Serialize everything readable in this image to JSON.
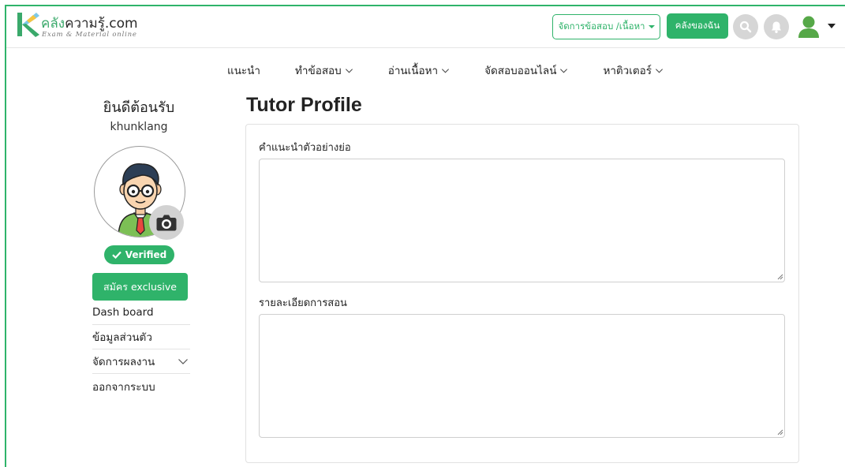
{
  "header": {
    "logo_letter": "K",
    "logo_parts": [
      "คลัง",
      "ความรู้",
      ".com"
    ],
    "logo_tagline": "Exam & Material online",
    "manage_button": "จัดการข้อสอบ /เนื้อหา",
    "my_store_button": "คลังของฉัน"
  },
  "nav": {
    "items": [
      {
        "label": "แนะนำ"
      },
      {
        "label": "ทำข้อสอบ"
      },
      {
        "label": "อ่านเนื้อหา"
      },
      {
        "label": "จัดสอบออนไลน์"
      },
      {
        "label": "หาติวเตอร์"
      }
    ]
  },
  "sidebar": {
    "welcome": "ยินดีต้อนรับ",
    "username": "khunklang",
    "verified_label": "Verified",
    "exclusive_button": "สมัคร exclusive",
    "menu": [
      {
        "label": "Dash board"
      },
      {
        "label": "ข้อมูลส่วนตัว"
      },
      {
        "label": "จัดการผลงาน"
      },
      {
        "label": "ออกจากระบบ"
      }
    ]
  },
  "main": {
    "title": "Tutor Profile",
    "fields": [
      {
        "label": "คำแนะนำตัวอย่างย่อ",
        "value": ""
      },
      {
        "label": "รายละเอียดการสอน",
        "value": ""
      }
    ]
  },
  "colors": {
    "brand_green": "#2fb36a",
    "icon_gray": "#d6d6d6"
  },
  "icons": [
    "search-icon",
    "bell-icon",
    "user-icon",
    "camera-icon",
    "check-icon",
    "chevron-down-icon"
  ]
}
